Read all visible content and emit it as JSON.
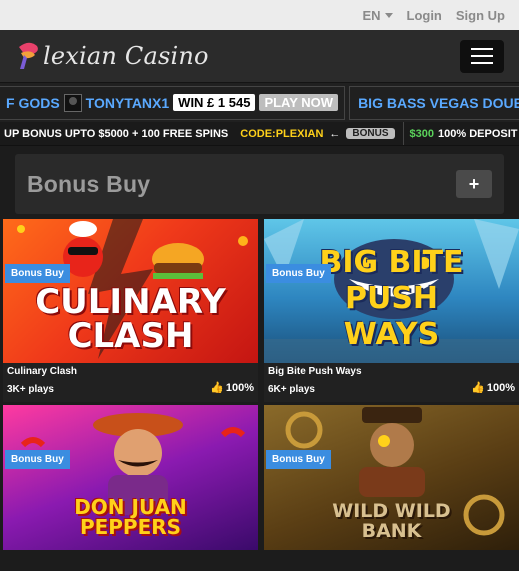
{
  "topbar": {
    "lang": "EN",
    "login": "Login",
    "signup": "Sign Up"
  },
  "header": {
    "logo_text": "lexian Casino",
    "menu_icon": "hamburger-icon"
  },
  "ticker": {
    "game1": "F GODS",
    "user": "TONYTANX1",
    "win": "WIN £ 1 545",
    "play": "PLAY NOW",
    "game2": "BIG BASS VEGAS DOUB"
  },
  "promo": {
    "text1": "UP BONUS UPTO $5000 + 100 FREE SPINS",
    "code": "CODE:PLEXIAN",
    "arrow": "←",
    "tag": "BONUS",
    "amount": "$300",
    "text2": "100% DEPOSIT S"
  },
  "section": {
    "title": "Bonus Buy",
    "expand": "+"
  },
  "games": [
    {
      "badge": "Bonus Buy",
      "art_title": "CULINARY CLASH",
      "name": "Culinary Clash",
      "plays": "3K+ plays",
      "rating": "100%"
    },
    {
      "badge": "Bonus Buy",
      "art_title": "BIG BITE PUSH WAYS",
      "name": "Big Bite Push Ways",
      "plays": "6K+ plays",
      "rating": "100%"
    },
    {
      "badge": "Bonus Buy",
      "art_title": "DON JUAN PEPPERS",
      "name": "",
      "plays": "",
      "rating": ""
    },
    {
      "badge": "Bonus Buy",
      "art_title": "WILD WILD BANK",
      "name": "",
      "plays": "",
      "rating": ""
    }
  ],
  "colors": {
    "accent": "#3b8de0",
    "code": "#ffd11a",
    "green": "#5bd35b",
    "thumb": "#f7b22b"
  }
}
